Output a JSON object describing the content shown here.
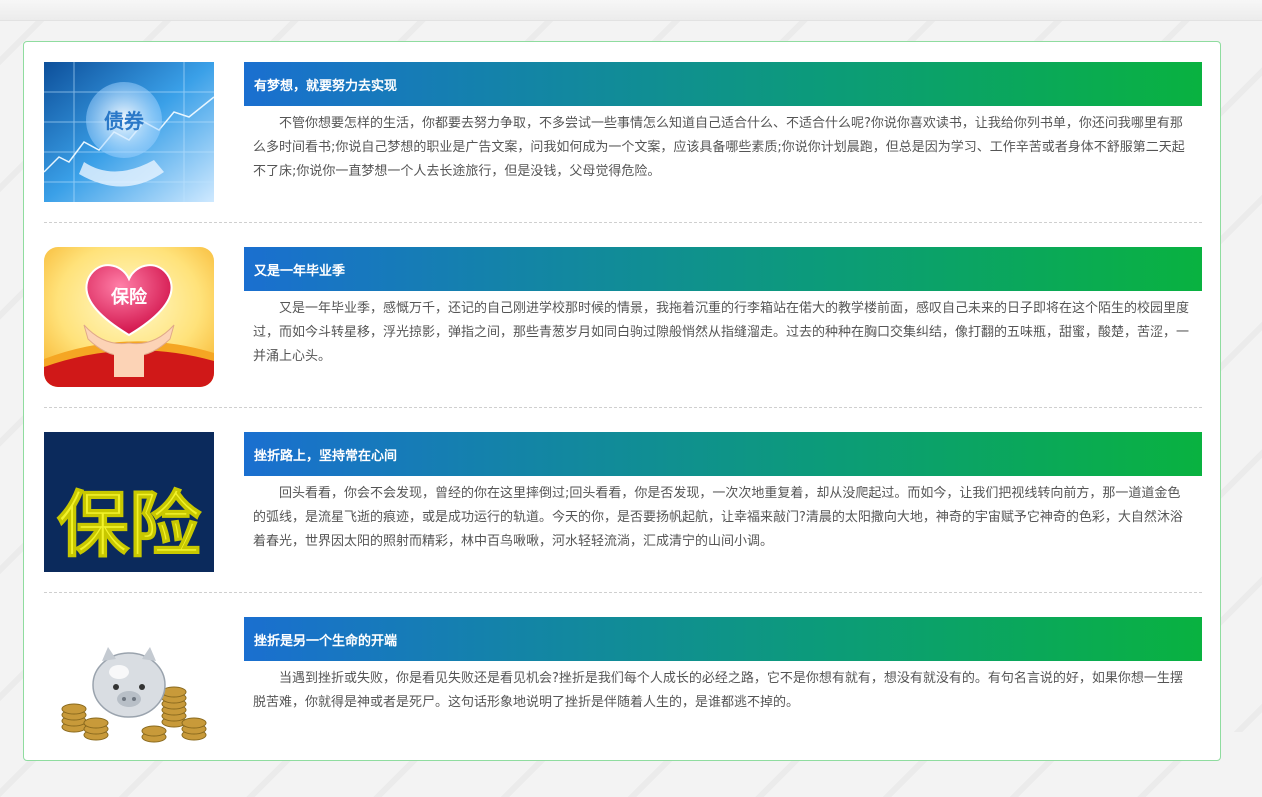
{
  "articles": [
    {
      "title": "有梦想，就要努力去实现",
      "text": "不管你想要怎样的生活，你都要去努力争取，不多尝试一些事情怎么知道自己适合什么、不适合什么呢?你说你喜欢读书，让我给你列书单，你还问我哪里有那么多时间看书;你说自己梦想的职业是广告文案，问我如何成为一个文案，应该具备哪些素质;你说你计划晨跑，但总是因为学习、工作辛苦或者身体不舒服第二天起不了床;你说你一直梦想一个人去长途旅行，但是没钱，父母觉得危险。",
      "image_label": "债券",
      "image_icon": "bond-icon"
    },
    {
      "title": "又是一年毕业季",
      "text": "又是一年毕业季，感慨万千，还记的自己刚进学校那时候的情景，我拖着沉重的行李箱站在偌大的教学楼前面，感叹自己未来的日子即将在这个陌生的校园里度过，而如今斗转星移，浮光掠影，弹指之间，那些青葱岁月如同白驹过隙般悄然从指缝溜走。过去的种种在胸口交集纠结，像打翻的五味瓶，甜蜜，酸楚，苦涩，一并涌上心头。",
      "image_label": "保险",
      "image_icon": "heart-hands-icon"
    },
    {
      "title": "挫折路上，坚持常在心间",
      "text": "回头看看，你会不会发现，曾经的你在这里摔倒过;回头看看，你是否发现，一次次地重复着，却从没爬起过。而如今，让我们把视线转向前方，那一道道金色的弧线，是流星飞逝的痕迹，或是成功运行的轨道。今天的你，是否要扬帆起航，让幸福来敲门?清晨的太阳撒向大地，神奇的宇宙赋予它神奇的色彩，大自然沐浴着春光，世界因太阳的照射而精彩，林中百鸟啾啾，河水轻轻流淌，汇成清宁的山间小调。",
      "image_label": "保险",
      "image_icon": "insurance-sign-icon"
    },
    {
      "title": "挫折是另一个生命的开端",
      "text": "当遇到挫折或失败，你是看见失败还是看见机会?挫折是我们每个人成长的必经之路，它不是你想有就有，想没有就没有的。有句名言说的好，如果你想一生摆脱苦难，你就得是神或者是死尸。这句话形象地说明了挫折是伴随着人生的，是谁都逃不掉的。",
      "image_icon": "piggy-bank-coins-icon"
    }
  ]
}
